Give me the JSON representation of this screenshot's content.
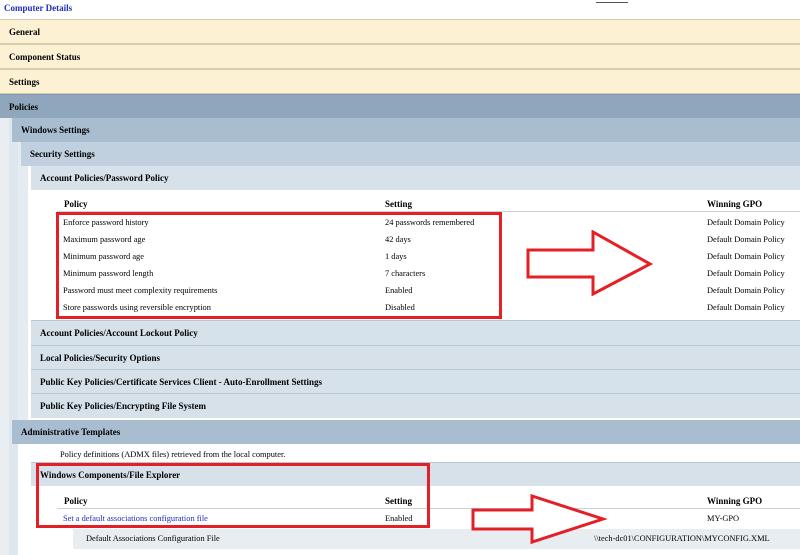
{
  "header": {
    "title": "Computer Details"
  },
  "sections": {
    "general": "General",
    "component_status": "Component Status",
    "settings": "Settings",
    "policies": "Policies",
    "windows_settings": "Windows Settings",
    "security_settings": "Security Settings",
    "password_policy": "Account Policies/Password Policy",
    "lockout_policy": "Account Policies/Account Lockout Policy",
    "local_policies": "Local Policies/Security Options",
    "pk_cert": "Public Key Policies/Certificate Services Client - Auto-Enrollment Settings",
    "pk_efs": "Public Key Policies/Encrypting File System",
    "admin_templates": "Administrative Templates",
    "admx_note": "Policy definitions (ADMX files) retrieved from the local computer.",
    "file_explorer": "Windows Components/File Explorer"
  },
  "password_table": {
    "columns": {
      "policy": "Policy",
      "setting": "Setting",
      "gpo": "Winning GPO"
    },
    "rows": [
      {
        "policy": "Enforce password history",
        "setting": "24 passwords remembered",
        "gpo": "Default Domain Policy"
      },
      {
        "policy": "Maximum password age",
        "setting": "42 days",
        "gpo": "Default Domain Policy"
      },
      {
        "policy": "Minimum password age",
        "setting": "1 days",
        "gpo": "Default Domain Policy"
      },
      {
        "policy": "Minimum password length",
        "setting": "7 characters",
        "gpo": "Default Domain Policy"
      },
      {
        "policy": "Password must meet complexity requirements",
        "setting": "Enabled",
        "gpo": "Default Domain Policy"
      },
      {
        "policy": "Store passwords using reversible encryption",
        "setting": "Disabled",
        "gpo": "Default Domain Policy"
      }
    ]
  },
  "explorer_table": {
    "columns": {
      "policy": "Policy",
      "setting": "Setting",
      "gpo": "Winning GPO"
    },
    "row": {
      "policy": "Set a default associations configuration file",
      "setting": "Enabled",
      "gpo": "MY-GPO"
    },
    "subrow": {
      "label": "Default Associations Configuration File",
      "value": "\\\\tech-dc01\\CONFIGURATION\\MYCONFIG.XML"
    }
  },
  "colors": {
    "annotation_red": "#e32026",
    "beige_bar": "#fdf1d4",
    "blue_bar": "#8fa6bd",
    "link_blue": "#1f2dbf"
  }
}
